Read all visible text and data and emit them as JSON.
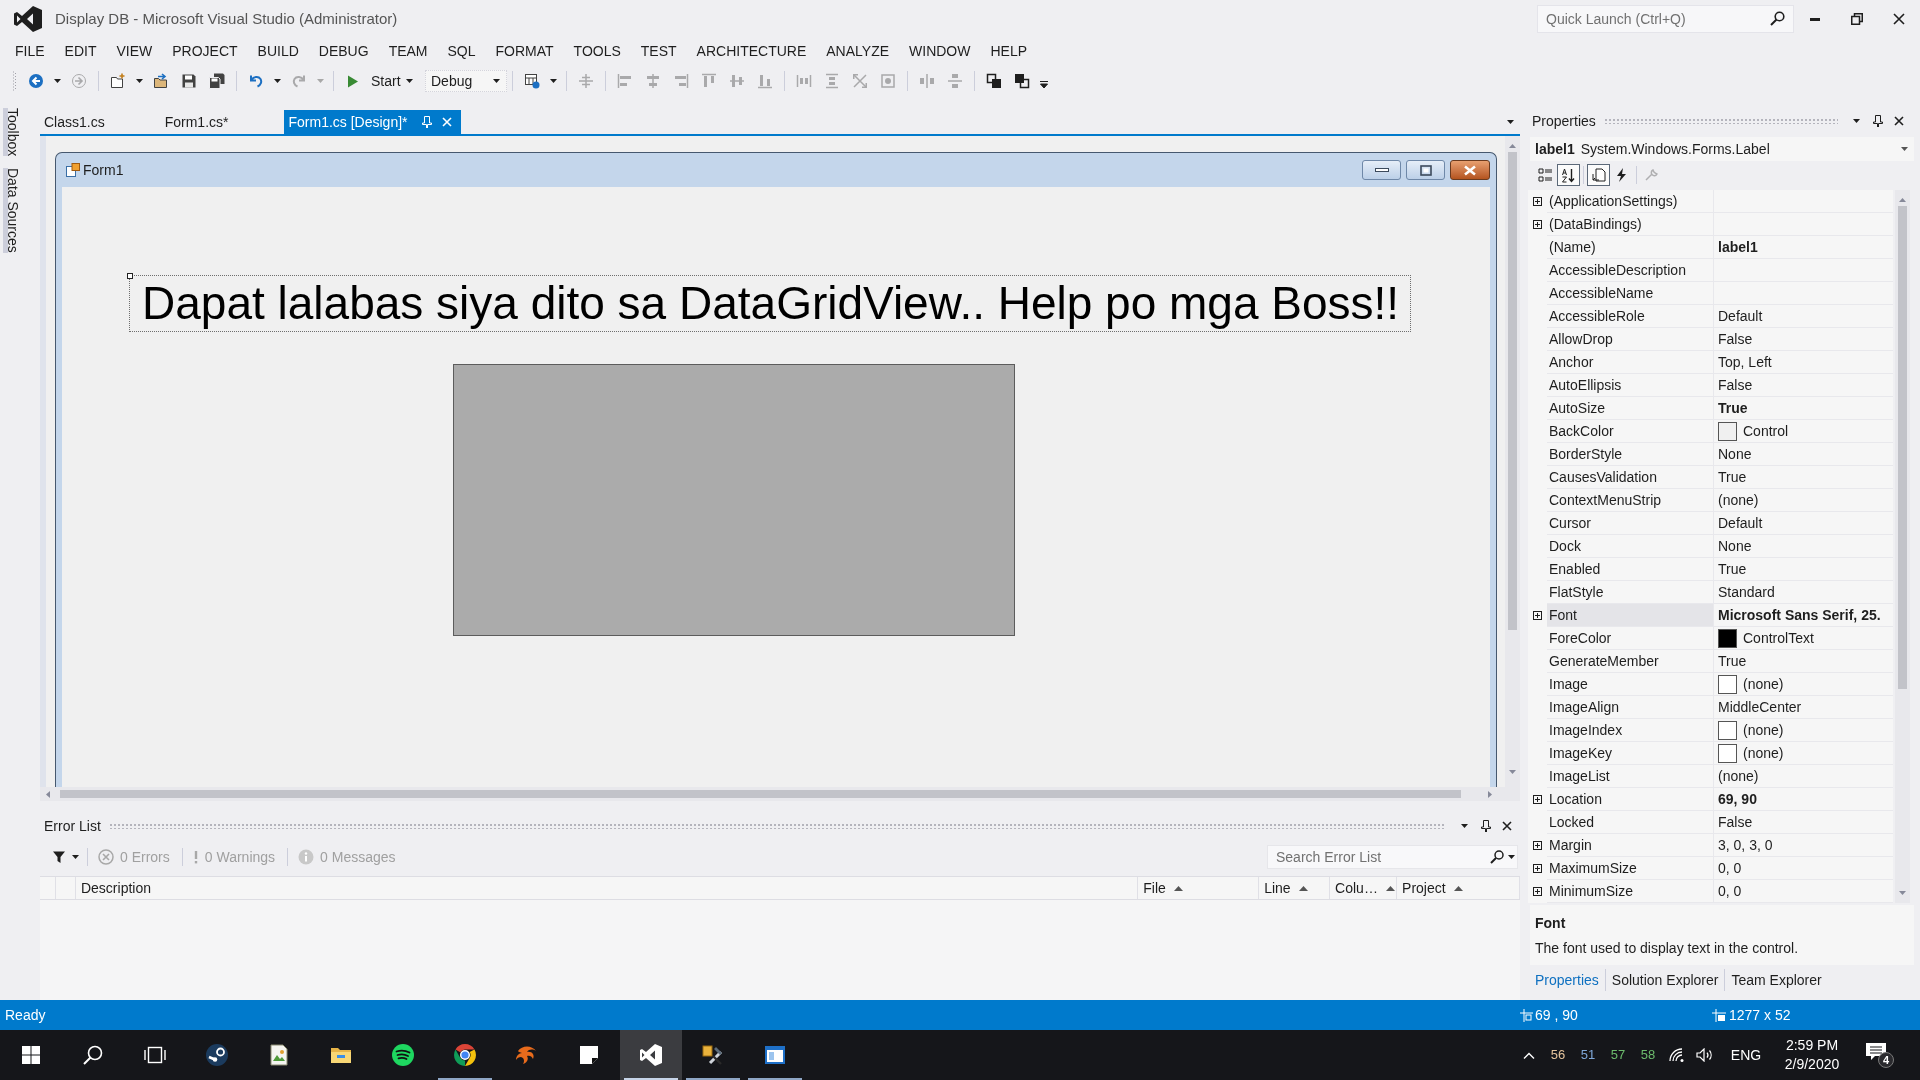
{
  "window": {
    "title": "Display DB - Microsoft Visual Studio (Administrator)",
    "quick_launch": {
      "placeholder": "Quick Launch (Ctrl+Q)"
    }
  },
  "menu": [
    "FILE",
    "EDIT",
    "VIEW",
    "PROJECT",
    "BUILD",
    "DEBUG",
    "TEAM",
    "SQL",
    "FORMAT",
    "TOOLS",
    "TEST",
    "ARCHITECTURE",
    "ANALYZE",
    "WINDOW",
    "HELP"
  ],
  "toolbar": {
    "items": [
      {
        "kind": "icon",
        "disabled": false,
        "dropdown": true
      },
      {
        "kind": "icon",
        "disabled": true,
        "dropdown": false
      },
      {
        "kind": "separator"
      },
      {
        "kind": "icon",
        "disabled": false,
        "dropdown": true
      },
      {
        "kind": "icon",
        "disabled": false,
        "dropdown": false
      },
      {
        "kind": "icon",
        "disabled": false,
        "dropdown": false
      },
      {
        "kind": "icon",
        "disabled": false,
        "dropdown": false
      },
      {
        "kind": "separator"
      },
      {
        "kind": "icon",
        "disabled": false,
        "dropdown": true
      },
      {
        "kind": "icon",
        "disabled": true,
        "dropdown": true
      },
      {
        "kind": "separator"
      },
      {
        "kind": "start",
        "label": "Start",
        "dropdown": true
      },
      {
        "kind": "combo",
        "value": "Debug"
      },
      {
        "kind": "separator"
      },
      {
        "kind": "icon",
        "disabled": false,
        "dropdown": true
      },
      {
        "kind": "separator"
      },
      {
        "kind": "icon",
        "disabled": true,
        "dropdown": false
      },
      {
        "kind": "separator"
      },
      {
        "kind": "icon",
        "disabled": true,
        "dropdown": false
      },
      {
        "kind": "icon",
        "disabled": true,
        "dropdown": false
      },
      {
        "kind": "icon",
        "disabled": true,
        "dropdown": false
      },
      {
        "kind": "icon",
        "disabled": true,
        "dropdown": false
      },
      {
        "kind": "icon",
        "disabled": true,
        "dropdown": false
      },
      {
        "kind": "icon",
        "disabled": true,
        "dropdown": false
      },
      {
        "kind": "separator"
      },
      {
        "kind": "icon",
        "disabled": true,
        "dropdown": false
      },
      {
        "kind": "icon",
        "disabled": true,
        "dropdown": false
      },
      {
        "kind": "icon",
        "disabled": true,
        "dropdown": false
      },
      {
        "kind": "icon",
        "disabled": true,
        "dropdown": false
      },
      {
        "kind": "separator"
      },
      {
        "kind": "icon",
        "disabled": true,
        "dropdown": false
      },
      {
        "kind": "icon",
        "disabled": true,
        "dropdown": false
      },
      {
        "kind": "separator"
      },
      {
        "kind": "icon",
        "disabled": false,
        "dropdown": false
      },
      {
        "kind": "icon",
        "disabled": false,
        "dropdown": false
      }
    ]
  },
  "side_tabs": [
    "Toolbox",
    "Data Sources"
  ],
  "document_tabs": [
    {
      "label": "Class1.cs",
      "selected": false
    },
    {
      "label": "Form1.cs*",
      "selected": false
    },
    {
      "label": "Form1.cs [Design]*",
      "selected": true
    }
  ],
  "designer": {
    "form": {
      "title": "Form1",
      "label": {
        "text": "Dapat lalabas siya dito sa DataGridView.. Help po mga Boss!!",
        "selected": true
      }
    }
  },
  "error_list": {
    "title": "Error List",
    "filters": [
      {
        "kind": "error",
        "label": "0 Errors",
        "disabled": true
      },
      {
        "kind": "warning",
        "label": "0 Warnings",
        "disabled": true
      },
      {
        "kind": "message",
        "label": "0 Messages",
        "disabled": true
      }
    ],
    "search": {
      "placeholder": "Search Error List"
    },
    "columns": [
      {
        "label": "Description",
        "sorted": false
      },
      {
        "label": "File",
        "sorted": true
      },
      {
        "label": "Line",
        "sorted": true
      },
      {
        "label": "Colu…",
        "sorted": true
      },
      {
        "label": "Project",
        "sorted": true
      }
    ]
  },
  "properties": {
    "title": "Properties",
    "object": {
      "name": "label1",
      "type": "System.Windows.Forms.Label"
    },
    "toolbar": [
      {
        "selected": false,
        "disabled": false
      },
      {
        "selected": true,
        "disabled": false
      },
      {
        "selected": true,
        "disabled": false
      },
      {
        "selected": false,
        "disabled": false
      },
      {
        "selected": false,
        "disabled": true
      }
    ],
    "rows": [
      {
        "name": "(ApplicationSettings)",
        "kind": "text",
        "expandable": true,
        "selected": false
      },
      {
        "name": "(DataBindings)",
        "kind": "text",
        "expandable": true,
        "selected": false
      },
      {
        "name": "(Name)",
        "value": "label1",
        "kind": "text",
        "expandable": false,
        "modified": true,
        "selected": false
      },
      {
        "name": "AccessibleDescription",
        "kind": "text",
        "expandable": false,
        "selected": false
      },
      {
        "name": "AccessibleName",
        "kind": "text",
        "expandable": false,
        "selected": false
      },
      {
        "name": "AccessibleRole",
        "value": "Default",
        "kind": "text",
        "expandable": false,
        "modified": false,
        "selected": false
      },
      {
        "name": "AllowDrop",
        "value": "False",
        "kind": "text",
        "expandable": false,
        "modified": false,
        "selected": false
      },
      {
        "name": "Anchor",
        "value": "Top, Left",
        "kind": "text",
        "expandable": false,
        "modified": false,
        "selected": false
      },
      {
        "name": "AutoEllipsis",
        "value": "False",
        "kind": "text",
        "expandable": false,
        "modified": false,
        "selected": false
      },
      {
        "name": "AutoSize",
        "value": "True",
        "kind": "text",
        "expandable": false,
        "modified": true,
        "selected": false
      },
      {
        "name": "BackColor",
        "value": "Control",
        "kind": "color",
        "color": "#f0f0f0",
        "expandable": false,
        "modified": false,
        "selected": false
      },
      {
        "name": "BorderStyle",
        "value": "None",
        "kind": "text",
        "expandable": false,
        "modified": false,
        "selected": false
      },
      {
        "name": "CausesValidation",
        "value": "True",
        "kind": "text",
        "expandable": false,
        "modified": false,
        "selected": false
      },
      {
        "name": "ContextMenuStrip",
        "value": "(none)",
        "kind": "text",
        "expandable": false,
        "modified": false,
        "selected": false
      },
      {
        "name": "Cursor",
        "value": "Default",
        "kind": "text",
        "expandable": false,
        "modified": false,
        "selected": false
      },
      {
        "name": "Dock",
        "value": "None",
        "kind": "text",
        "expandable": false,
        "modified": false,
        "selected": false
      },
      {
        "name": "Enabled",
        "value": "True",
        "kind": "text",
        "expandable": false,
        "modified": false,
        "selected": false
      },
      {
        "name": "FlatStyle",
        "value": "Standard",
        "kind": "text",
        "expandable": false,
        "modified": false,
        "selected": false
      },
      {
        "name": "Font",
        "value": "Microsoft Sans Serif, 25.",
        "kind": "text",
        "expandable": true,
        "modified": true,
        "selected": true
      },
      {
        "name": "ForeColor",
        "value": "ControlText",
        "kind": "color",
        "color": "#000000",
        "expandable": false,
        "modified": false,
        "selected": false
      },
      {
        "name": "GenerateMember",
        "value": "True",
        "kind": "text",
        "expandable": false,
        "modified": false,
        "selected": false
      },
      {
        "name": "Image",
        "value": "(none)",
        "kind": "image",
        "expandable": false,
        "modified": false,
        "selected": false
      },
      {
        "name": "ImageAlign",
        "value": "MiddleCenter",
        "kind": "text",
        "expandable": false,
        "modified": false,
        "selected": false
      },
      {
        "name": "ImageIndex",
        "value": "(none)",
        "kind": "image",
        "expandable": false,
        "modified": false,
        "selected": false
      },
      {
        "name": "ImageKey",
        "value": "(none)",
        "kind": "image",
        "expandable": false,
        "modified": false,
        "selected": false
      },
      {
        "name": "ImageList",
        "value": "(none)",
        "kind": "text",
        "expandable": false,
        "modified": false,
        "selected": false
      },
      {
        "name": "Location",
        "value": "69, 90",
        "kind": "text",
        "expandable": true,
        "modified": true,
        "selected": false
      },
      {
        "name": "Locked",
        "value": "False",
        "kind": "text",
        "expandable": false,
        "modified": false,
        "selected": false
      },
      {
        "name": "Margin",
        "value": "3, 0, 3, 0",
        "kind": "text",
        "expandable": true,
        "modified": false,
        "selected": false
      },
      {
        "name": "MaximumSize",
        "value": "0, 0",
        "kind": "text",
        "expandable": true,
        "modified": false,
        "selected": false
      },
      {
        "name": "MinimumSize",
        "value": "0, 0",
        "kind": "text",
        "expandable": true,
        "modified": false,
        "selected": false
      }
    ],
    "description": {
      "title": "Font",
      "text": "The font used to display text in the control."
    },
    "tabs": [
      {
        "label": "Properties",
        "selected": true
      },
      {
        "label": "Solution Explorer",
        "selected": false
      },
      {
        "label": "Team Explorer",
        "selected": false
      }
    ]
  },
  "status_bar": {
    "text": "Ready",
    "position": "69 , 90",
    "size": "1277 x 52"
  },
  "taskbar": {
    "apps": [
      {
        "running": false,
        "active": false
      },
      {
        "running": false,
        "active": false
      },
      {
        "running": false,
        "active": false
      },
      {
        "running": false,
        "active": false
      },
      {
        "running": true,
        "active": false
      },
      {
        "running": false,
        "active": false
      },
      {
        "running": false,
        "active": false
      },
      {
        "running": true,
        "active": true
      },
      {
        "running": true,
        "active": false
      },
      {
        "running": true,
        "active": false
      }
    ],
    "tray": {
      "readings": [
        {
          "text": "56",
          "color": "#e6c49c"
        },
        {
          "text": "51",
          "color": "#7fa7d8"
        },
        {
          "text": "57",
          "color": "#6cbb6c"
        },
        {
          "text": "58",
          "color": "#6cbb6c"
        }
      ],
      "language": "ENG",
      "time": "2:59 PM",
      "date": "2/9/2020",
      "notification_count": "4"
    }
  }
}
